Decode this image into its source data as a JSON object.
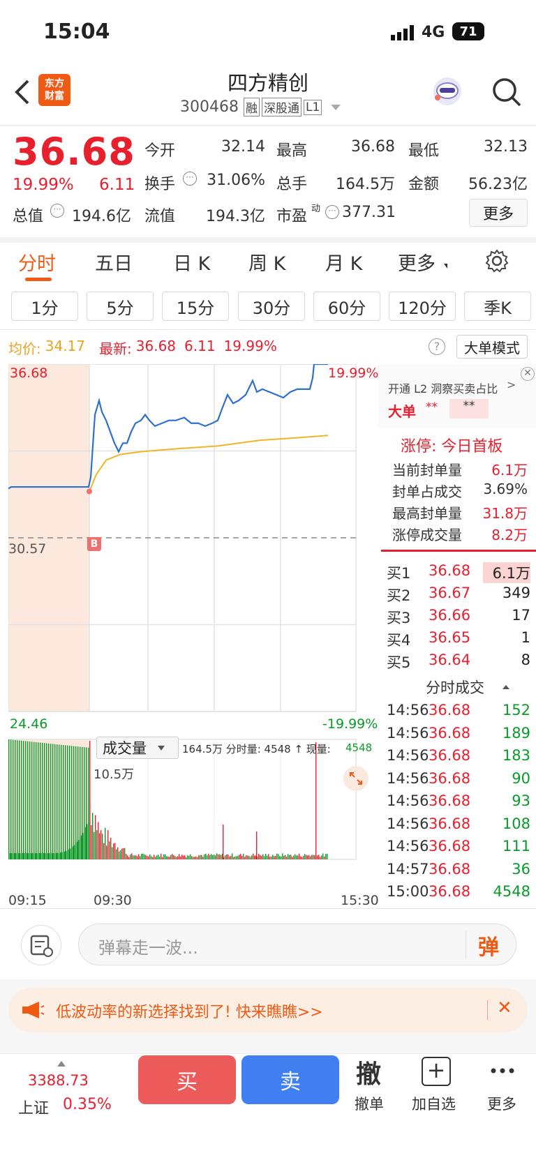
{
  "status": {
    "time": "15:04",
    "network": "4G",
    "battery": "71"
  },
  "nav": {
    "title": "四方精创",
    "code": "300468",
    "tags": [
      "融",
      "深股通",
      "L1"
    ],
    "logo": "东方财富"
  },
  "quote": {
    "price": "36.68",
    "pct": "19.99%",
    "chg": "6.11",
    "cells": [
      {
        "l": "今开",
        "v": "32.14",
        "c": "red"
      },
      {
        "l": "最高",
        "v": "36.68",
        "c": "red"
      },
      {
        "l": "最低",
        "v": "32.13",
        "c": "red"
      },
      {
        "l": "换手",
        "v": "31.06%",
        "c": "k"
      },
      {
        "l": "总手",
        "v": "164.5万",
        "c": "k"
      },
      {
        "l": "金额",
        "v": "56.23亿",
        "c": "k"
      },
      {
        "l": "总值",
        "v": "194.6亿",
        "c": "k"
      },
      {
        "l": "流值",
        "v": "194.3亿",
        "c": "k"
      },
      {
        "l": "市盈",
        "v": "377.31",
        "c": "k"
      }
    ],
    "more": "更多"
  },
  "tabs": [
    "分时",
    "五日",
    "日 K",
    "周 K",
    "月 K",
    "更多"
  ],
  "periods": [
    "1分",
    "5分",
    "15分",
    "30分",
    "60分",
    "120分",
    "季K"
  ],
  "infobar": {
    "avg_label": "均价:",
    "avg": "34.17",
    "latest_label": "最新:",
    "latest": "36.68",
    "chg": "6.11",
    "pct": "19.99%",
    "mode": "大单模式"
  },
  "chart": {
    "ymax": "36.68",
    "ymid": "30.57",
    "ymin": "24.46",
    "pmax": "19.99%",
    "pmin": "-19.99%",
    "vol_label": "成交量",
    "vol_info": "164.5万 分时量: 4548 ↑ 现量:",
    "vol_now": "4548",
    "vol_max": "10.5万",
    "t_start": "09:15",
    "t_mid": "09:30",
    "t_end": "15:30",
    "marker": "B"
  },
  "chart_data": {
    "type": "line",
    "x_label_ticks": [
      "09:15",
      "09:30",
      "15:30"
    ],
    "ylim": [
      24.46,
      36.68
    ],
    "prev_close": 30.57,
    "series": [
      {
        "name": "均价",
        "values": [
          32.2,
          32.8,
          33.3,
          33.5,
          33.6,
          33.7,
          33.8,
          34.0,
          34.1,
          34.17
        ]
      }
    ]
  },
  "side": {
    "l2": "开通 L2 洞察买卖占比",
    "big": "大单",
    "bigstars": "**",
    "bigstars2": "**",
    "limit_title": "涨停: 今日首板",
    "limit_rows": [
      {
        "l": "当前封单量",
        "v": "6.1万",
        "c": "red"
      },
      {
        "l": "封单占成交",
        "v": "3.69%",
        "c": "k"
      },
      {
        "l": "最高封单量",
        "v": "31.8万",
        "c": "red"
      },
      {
        "l": "涨停成交量",
        "v": "8.2万",
        "c": "red"
      }
    ],
    "book": [
      {
        "l": "买1",
        "p": "36.68",
        "v": "6.1万"
      },
      {
        "l": "买2",
        "p": "36.67",
        "v": "349"
      },
      {
        "l": "买3",
        "p": "36.66",
        "v": "17"
      },
      {
        "l": "买4",
        "p": "36.65",
        "v": "1"
      },
      {
        "l": "买5",
        "p": "36.64",
        "v": "8"
      }
    ],
    "trades_title": "分时成交",
    "trades": [
      {
        "t": "14:56",
        "p": "36.68",
        "v": "152"
      },
      {
        "t": "14:56",
        "p": "36.68",
        "v": "189"
      },
      {
        "t": "14:56",
        "p": "36.68",
        "v": "183"
      },
      {
        "t": "14:56",
        "p": "36.68",
        "v": "90"
      },
      {
        "t": "14:56",
        "p": "36.68",
        "v": "93"
      },
      {
        "t": "14:56",
        "p": "36.68",
        "v": "108"
      },
      {
        "t": "14:56",
        "p": "36.68",
        "v": "111"
      },
      {
        "t": "14:57",
        "p": "36.68",
        "v": "36"
      },
      {
        "t": "15:00",
        "p": "36.68",
        "v": "4548"
      }
    ]
  },
  "danmu": {
    "placeholder": "弹幕走一波...",
    "btn": "弹"
  },
  "banner": {
    "text": "低波动率的新选择找到了! 快来瞧瞧>>"
  },
  "bottom": {
    "index_val": "3388.73",
    "index_name": "上证",
    "index_pct": "0.35%",
    "buy": "买",
    "sell": "卖",
    "cancel_glyph": "撤",
    "cancel": "撤单",
    "add": "加自选",
    "more": "更多"
  },
  "colors": {
    "red": "#e8202e",
    "green": "#0a9a2a",
    "blue": "#2f6fd0",
    "avg": "#f0b428",
    "buy": "#ec5a5a",
    "sell": "#3f7ff0",
    "accent": "#f05a14"
  }
}
